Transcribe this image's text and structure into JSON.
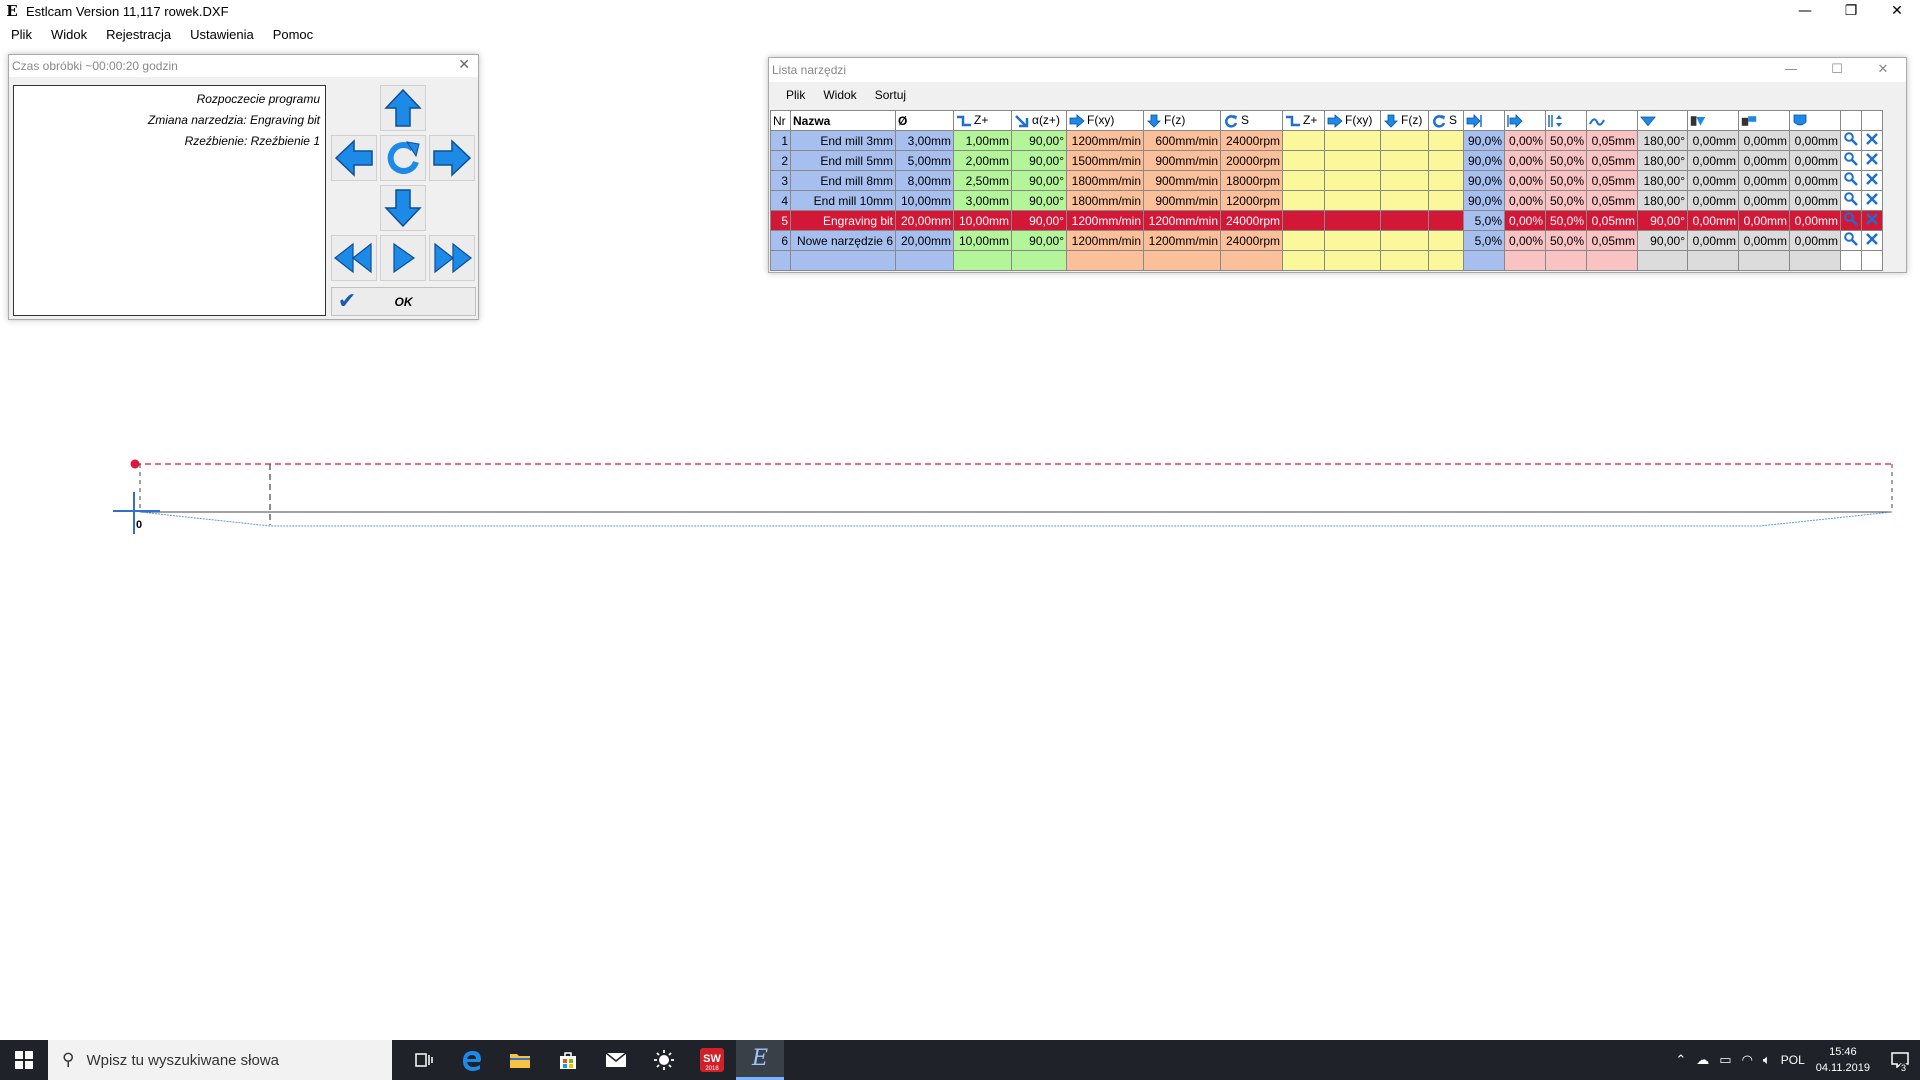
{
  "window": {
    "title": "Estlcam Version 11,117 rowek.DXF",
    "app_icon": "E",
    "minimize": "—",
    "restore": "❐",
    "close": "✕"
  },
  "menu": [
    "Plik",
    "Widok",
    "Rejestracja",
    "Ustawienia",
    "Pomoc"
  ],
  "machining_dialog": {
    "title": "Czas obróbki ~00:00:20 godzin",
    "close": "✕",
    "log": [
      "Rozpoczecie programu",
      "Zmiana narzedzia: Engraving bit",
      "Rzeźbienie: Rzeźbienie 1"
    ],
    "ok_label": "OK",
    "icons": [
      "arrow-up-icon",
      "arrow-left-icon",
      "rotate-icon",
      "arrow-right-icon",
      "arrow-down-icon",
      "rewind-icon",
      "play-icon",
      "fast-forward-icon",
      "check-icon"
    ]
  },
  "tool_dialog": {
    "title": "Lista narzędzi",
    "minimize": "—",
    "maximize": "☐",
    "close": "✕",
    "menu": [
      "Plik",
      "Widok",
      "Sortuj"
    ],
    "headers": [
      "Nr",
      "Nazwa",
      "Ø",
      "Z+",
      "α(z+)",
      "F(xy)",
      "F(z)",
      "S",
      "Z+",
      "F(xy)",
      "F(z)",
      "S",
      "",
      "",
      "",
      "",
      "",
      "",
      "",
      "",
      "",
      ""
    ],
    "rows": [
      {
        "nr": "1",
        "name": "End mill 3mm",
        "d": "3,00mm",
        "z": "1,00mm",
        "a": "90,00°",
        "fxy": "1200mm/min",
        "fz": "600mm/min",
        "s": "24000rpm",
        "p1": "90,0%",
        "p2": "0,00%",
        "p3": "50,0%",
        "p4": "0,05mm",
        "g1": "180,00°",
        "g2": "0,00mm",
        "g3": "0,00mm",
        "g4": "0,00mm"
      },
      {
        "nr": "2",
        "name": "End mill 5mm",
        "d": "5,00mm",
        "z": "2,00mm",
        "a": "90,00°",
        "fxy": "1500mm/min",
        "fz": "900mm/min",
        "s": "20000rpm",
        "p1": "90,0%",
        "p2": "0,00%",
        "p3": "50,0%",
        "p4": "0,05mm",
        "g1": "180,00°",
        "g2": "0,00mm",
        "g3": "0,00mm",
        "g4": "0,00mm"
      },
      {
        "nr": "3",
        "name": "End mill 8mm",
        "d": "8,00mm",
        "z": "2,50mm",
        "a": "90,00°",
        "fxy": "1800mm/min",
        "fz": "900mm/min",
        "s": "18000rpm",
        "p1": "90,0%",
        "p2": "0,00%",
        "p3": "50,0%",
        "p4": "0,05mm",
        "g1": "180,00°",
        "g2": "0,00mm",
        "g3": "0,00mm",
        "g4": "0,00mm"
      },
      {
        "nr": "4",
        "name": "End mill 10mm",
        "d": "10,00mm",
        "z": "3,00mm",
        "a": "90,00°",
        "fxy": "1800mm/min",
        "fz": "900mm/min",
        "s": "12000rpm",
        "p1": "90,0%",
        "p2": "0,00%",
        "p3": "50,0%",
        "p4": "0,05mm",
        "g1": "180,00°",
        "g2": "0,00mm",
        "g3": "0,00mm",
        "g4": "0,00mm"
      },
      {
        "nr": "5",
        "name": "Engraving bit",
        "d": "20,00mm",
        "z": "10,00mm",
        "a": "90,00°",
        "fxy": "1200mm/min",
        "fz": "1200mm/min",
        "s": "24000rpm",
        "p1": "5,0%",
        "p2": "0,00%",
        "p3": "50,0%",
        "p4": "0,05mm",
        "g1": "90,00°",
        "g2": "0,00mm",
        "g3": "0,00mm",
        "g4": "0,00mm"
      },
      {
        "nr": "6",
        "name": "Nowe narzędzie 6",
        "d": "20,00mm",
        "z": "10,00mm",
        "a": "90,00°",
        "fxy": "1200mm/min",
        "fz": "1200mm/min",
        "s": "24000rpm",
        "p1": "5,0%",
        "p2": "0,00%",
        "p3": "50,0%",
        "p4": "0,05mm",
        "g1": "90,00°",
        "g2": "0,00mm",
        "g3": "0,00mm",
        "g4": "0,00mm"
      }
    ],
    "selected_row": "5",
    "colors": {
      "blue": "#a7bfef",
      "green": "#b5f59a",
      "orange": "#fbc09a",
      "yellow": "#fbf89b",
      "pink": "#f9c2c3",
      "selected": "#d31737"
    }
  },
  "drawing": {
    "origin_label": "0",
    "colors": {
      "dashed": "#e0143c",
      "path": "#5b9ad9",
      "outline": "#444444",
      "origin": "#2f6fd0"
    }
  },
  "taskbar": {
    "search_placeholder": "Wpisz tu wyszukiwane słowa",
    "language": "POL",
    "time": "15:46",
    "date": "04.11.2019",
    "notification_count": "3",
    "icons": [
      "windows-start-icon",
      "search-icon",
      "task-view-icon",
      "edge-icon",
      "file-explorer-icon",
      "store-icon",
      "mail-icon",
      "weather-icon",
      "solidworks-icon",
      "estlcam-icon"
    ],
    "solidworks_label": "SW",
    "solidworks_year": "2018",
    "estlcam_label": "E"
  }
}
